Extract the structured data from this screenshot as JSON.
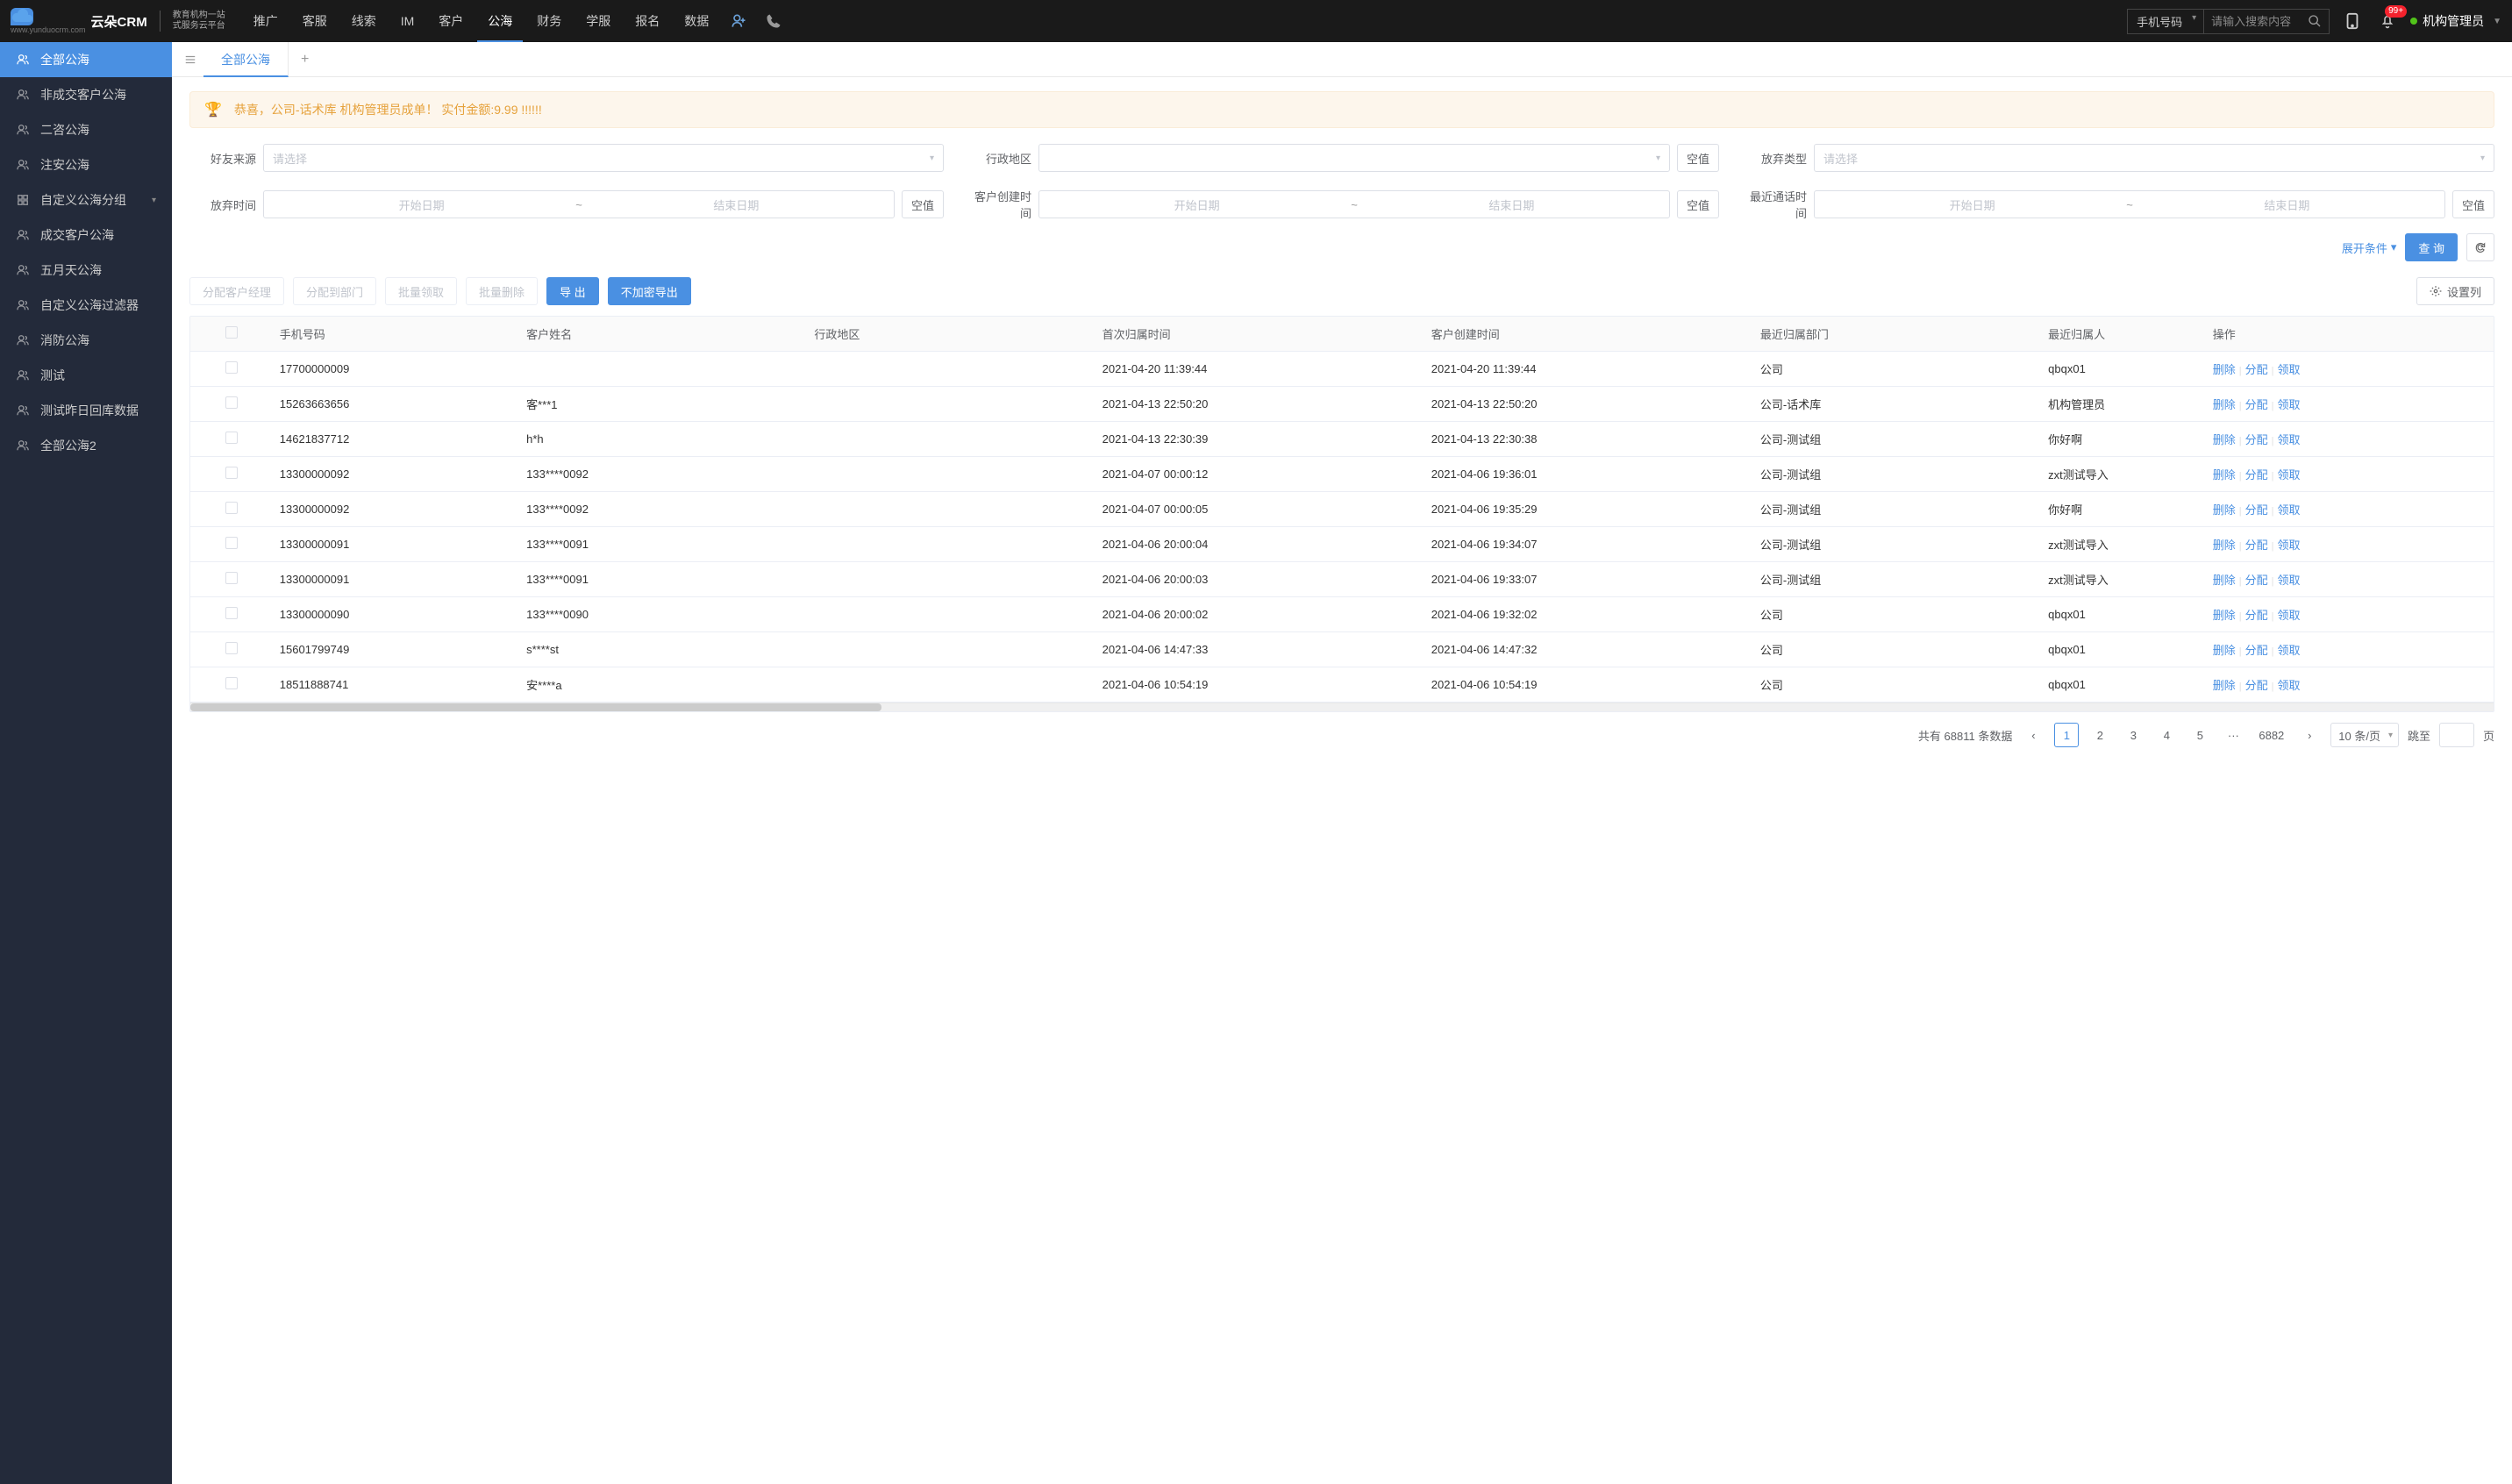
{
  "header": {
    "brand": "云朵CRM",
    "brand_url": "www.yunduocrm.com",
    "brand_sub1": "教育机构一站",
    "brand_sub2": "式服务云平台",
    "nav": [
      "推广",
      "客服",
      "线索",
      "IM",
      "客户",
      "公海",
      "财务",
      "学服",
      "报名",
      "数据"
    ],
    "nav_active": 5,
    "search_type": "手机号码",
    "search_placeholder": "请输入搜索内容",
    "badge": "99+",
    "user": "机构管理员"
  },
  "sidebar": {
    "items": [
      {
        "label": "全部公海",
        "icon": "user"
      },
      {
        "label": "非成交客户公海",
        "icon": "user"
      },
      {
        "label": "二咨公海",
        "icon": "user"
      },
      {
        "label": "注安公海",
        "icon": "user"
      },
      {
        "label": "自定义公海分组",
        "icon": "grid",
        "expandable": true
      },
      {
        "label": "成交客户公海",
        "icon": "user"
      },
      {
        "label": "五月天公海",
        "icon": "user"
      },
      {
        "label": "自定义公海过滤器",
        "icon": "user"
      },
      {
        "label": "消防公海",
        "icon": "user"
      },
      {
        "label": "测试",
        "icon": "user"
      },
      {
        "label": "测试昨日回库数据",
        "icon": "user"
      },
      {
        "label": "全部公海2",
        "icon": "user"
      }
    ],
    "active": 0
  },
  "tabs": {
    "items": [
      "全部公海"
    ],
    "active": 0
  },
  "announce": "恭喜，公司-话术库  机构管理员成单！ 实付金额:9.99 !!!!!!",
  "filters": {
    "friend_source": {
      "label": "好友来源",
      "placeholder": "请选择"
    },
    "admin_region": {
      "label": "行政地区",
      "null_btn": "空值"
    },
    "abandon_type": {
      "label": "放弃类型",
      "placeholder": "请选择"
    },
    "abandon_time": {
      "label": "放弃时间",
      "start": "开始日期",
      "end": "结束日期",
      "null_btn": "空值"
    },
    "customer_create_time": {
      "label": "客户创建时间",
      "start": "开始日期",
      "end": "结束日期",
      "null_btn": "空值"
    },
    "last_call_time": {
      "label": "最近通话时间",
      "start": "开始日期",
      "end": "结束日期",
      "null_btn": "空值"
    },
    "expand": "展开条件",
    "query_btn": "查 询"
  },
  "toolbar": {
    "assign_manager": "分配客户经理",
    "assign_dept": "分配到部门",
    "batch_claim": "批量领取",
    "batch_delete": "批量删除",
    "export": "导 出",
    "export_plain": "不加密导出",
    "set_columns": "设置列"
  },
  "table": {
    "columns": [
      "手机号码",
      "客户姓名",
      "行政地区",
      "首次归属时间",
      "客户创建时间",
      "最近归属部门",
      "最近归属人",
      "操作"
    ],
    "ops": {
      "delete": "删除",
      "assign": "分配",
      "claim": "领取"
    },
    "rows": [
      {
        "phone": "17700000009",
        "name": "",
        "region": "",
        "first_time": "2021-04-20 11:39:44",
        "create_time": "2021-04-20 11:39:44",
        "dept": "公司",
        "person": "qbqx01"
      },
      {
        "phone": "15263663656",
        "name": "客***1",
        "region": "",
        "first_time": "2021-04-13 22:50:20",
        "create_time": "2021-04-13 22:50:20",
        "dept": "公司-话术库",
        "person": "机构管理员"
      },
      {
        "phone": "14621837712",
        "name": "h*h",
        "region": "",
        "first_time": "2021-04-13 22:30:39",
        "create_time": "2021-04-13 22:30:38",
        "dept": "公司-测试组",
        "person": "你好啊"
      },
      {
        "phone": "13300000092",
        "name": "133****0092",
        "region": "",
        "first_time": "2021-04-07 00:00:12",
        "create_time": "2021-04-06 19:36:01",
        "dept": "公司-测试组",
        "person": "zxt测试导入"
      },
      {
        "phone": "13300000092",
        "name": "133****0092",
        "region": "",
        "first_time": "2021-04-07 00:00:05",
        "create_time": "2021-04-06 19:35:29",
        "dept": "公司-测试组",
        "person": "你好啊"
      },
      {
        "phone": "13300000091",
        "name": "133****0091",
        "region": "",
        "first_time": "2021-04-06 20:00:04",
        "create_time": "2021-04-06 19:34:07",
        "dept": "公司-测试组",
        "person": "zxt测试导入"
      },
      {
        "phone": "13300000091",
        "name": "133****0091",
        "region": "",
        "first_time": "2021-04-06 20:00:03",
        "create_time": "2021-04-06 19:33:07",
        "dept": "公司-测试组",
        "person": "zxt测试导入"
      },
      {
        "phone": "13300000090",
        "name": "133****0090",
        "region": "",
        "first_time": "2021-04-06 20:00:02",
        "create_time": "2021-04-06 19:32:02",
        "dept": "公司",
        "person": "qbqx01"
      },
      {
        "phone": "15601799749",
        "name": "s****st",
        "region": "",
        "first_time": "2021-04-06 14:47:33",
        "create_time": "2021-04-06 14:47:32",
        "dept": "公司",
        "person": "qbqx01"
      },
      {
        "phone": "18511888741",
        "name": "安****a",
        "region": "",
        "first_time": "2021-04-06 10:54:19",
        "create_time": "2021-04-06 10:54:19",
        "dept": "公司",
        "person": "qbqx01"
      }
    ]
  },
  "pagination": {
    "total_prefix": "共有",
    "total": "68811",
    "total_suffix": "条数据",
    "pages": [
      "1",
      "2",
      "3",
      "4",
      "5"
    ],
    "ellipsis": "···",
    "last": "6882",
    "page_size": "10 条/页",
    "jump_label": "跳至",
    "jump_suffix": "页"
  }
}
